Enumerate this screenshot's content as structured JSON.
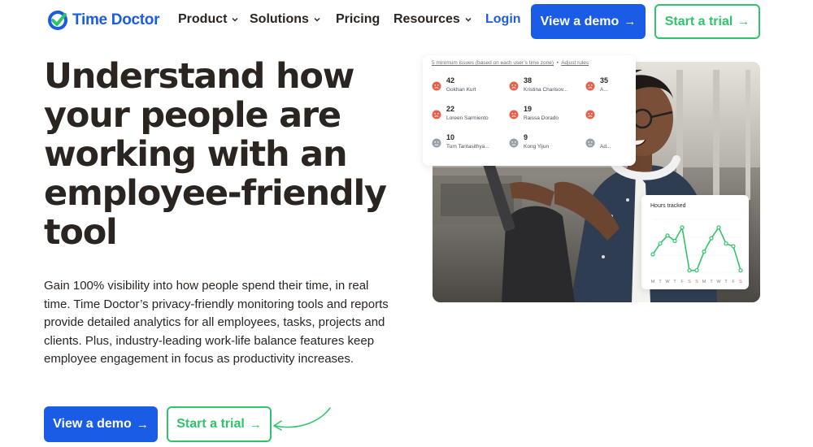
{
  "nav": {
    "logo_text": "Time Doctor",
    "brand_color": "#1a5ce6",
    "accent_green": "#2fc46b",
    "items": [
      {
        "label": "Product",
        "has_dropdown": true
      },
      {
        "label": "Solutions",
        "has_dropdown": true
      },
      {
        "label": "Pricing",
        "has_dropdown": false
      },
      {
        "label": "Resources",
        "has_dropdown": true
      }
    ],
    "login_label": "Login",
    "demo_label": "View a demo",
    "trial_label": "Start a trial"
  },
  "hero": {
    "title_lines": [
      "Understand how",
      "your people are",
      "working with an",
      "employee-friendly",
      "tool"
    ],
    "description": "Gain 100% visibility into how people spend their time, in real time. Time Doctor’s privacy-friendly monitoring tools and reports provide detailed analytics for all employees, tasks, projects and clients. Plus, industry-leading work-life balance features keep employee engagement in focus as productivity increases.",
    "demo_label": "View a demo",
    "trial_label": "Start a trial"
  },
  "issues_card": {
    "header_text": "5 minimum issues (based on each user’s time zone)",
    "header_link": "Adjust rules",
    "people": [
      {
        "count": "42",
        "name": "Gokhan Kurt",
        "mood": "sad"
      },
      {
        "count": "38",
        "name": "Kristina Charisov...",
        "mood": "sad"
      },
      {
        "count": "35",
        "name": "A...",
        "mood": "sad"
      },
      {
        "count": "22",
        "name": "Loreen Sarmiento",
        "mood": "sad"
      },
      {
        "count": "19",
        "name": "Raissa Dorado",
        "mood": "sad"
      },
      {
        "count": "",
        "name": "",
        "mood": "sad"
      },
      {
        "count": "10",
        "name": "Tum Tantasithya...",
        "mood": "neutral"
      },
      {
        "count": "9",
        "name": "Kong Yijun",
        "mood": "neutral"
      },
      {
        "count": "",
        "name": "Ad...",
        "mood": "neutral"
      }
    ]
  },
  "hours_card": {
    "title": "Hours tracked",
    "chart_data": {
      "type": "line",
      "x": [
        "M",
        "T",
        "W",
        "T",
        "F",
        "S",
        "S",
        "M",
        "T",
        "W",
        "T",
        "F",
        "S"
      ],
      "weekend_indices": [
        5,
        6,
        12
      ],
      "values": [
        0.35,
        0.55,
        0.7,
        0.6,
        0.85,
        0.05,
        0.05,
        0.4,
        0.65,
        0.85,
        0.55,
        0.5,
        0.05
      ],
      "ylim": [
        0,
        1
      ],
      "line_color": "#2fc46b",
      "weekend_color": "#e8604c"
    }
  }
}
